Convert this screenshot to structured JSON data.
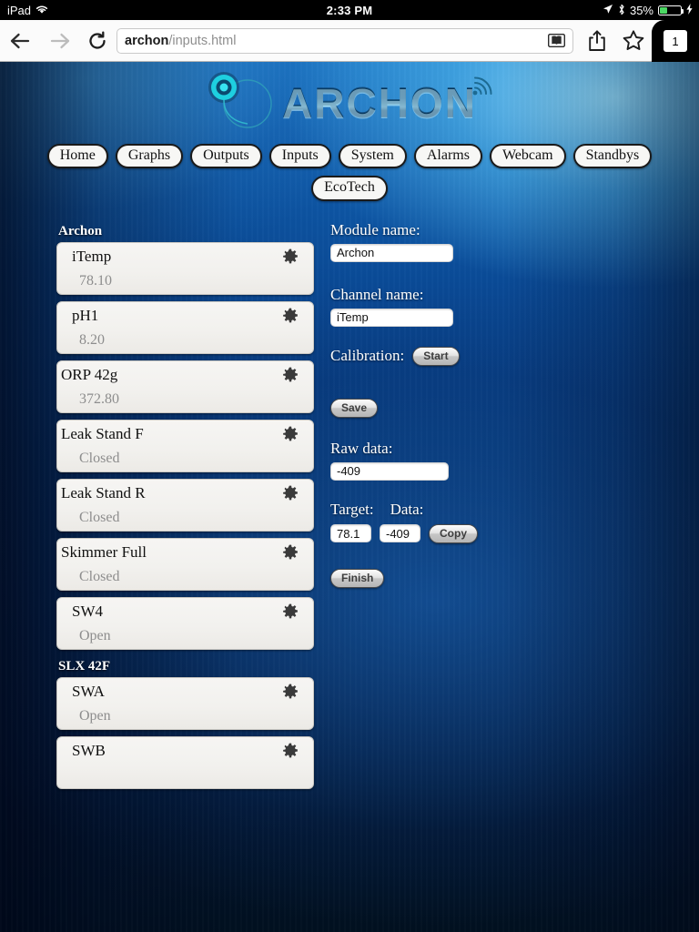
{
  "status_bar": {
    "carrier": "iPad",
    "wifi_icon": "wifi-icon",
    "time": "2:33 PM",
    "location_icon": "location-arrow-icon",
    "bluetooth_icon": "bluetooth-icon",
    "battery_percent": "35%",
    "battery_level": 35,
    "charging_icon": "lightning-bolt-icon",
    "battery_color": "#4cd964"
  },
  "browser": {
    "back_icon": "back-arrow-icon",
    "forward_icon": "forward-arrow-icon",
    "reload_icon": "reload-icon",
    "url_host": "archon",
    "url_path": "/inputs.html",
    "reader_icon": "reader-view-icon",
    "share_icon": "share-icon",
    "bookmark_icon": "star-icon",
    "tab_count": "1"
  },
  "site": {
    "logo_text": "ARCHON",
    "logo_mark_icon": "archon-swirl-icon",
    "logo_signal_icon": "signal-arcs-icon",
    "nav_row1": [
      {
        "label": "Home"
      },
      {
        "label": "Graphs"
      },
      {
        "label": "Outputs"
      },
      {
        "label": "Inputs"
      },
      {
        "label": "System"
      },
      {
        "label": "Alarms"
      },
      {
        "label": "Webcam"
      },
      {
        "label": "Standbys"
      }
    ],
    "nav_row2": [
      {
        "label": "EcoTech"
      }
    ]
  },
  "inputs_list": {
    "groups": [
      {
        "name": "Archon",
        "items": [
          {
            "title": "iTemp",
            "value": "78.10",
            "indent": true,
            "gear_icon": "gear-icon"
          },
          {
            "title": "pH1",
            "value": "8.20",
            "indent": true,
            "gear_icon": "gear-icon"
          },
          {
            "title": "ORP 42g",
            "value": "372.80",
            "indent": false,
            "gear_icon": "gear-icon"
          },
          {
            "title": "Leak Stand F",
            "value": "Closed",
            "indent": false,
            "gear_icon": "gear-icon"
          },
          {
            "title": "Leak Stand R",
            "value": "Closed",
            "indent": false,
            "gear_icon": "gear-icon"
          },
          {
            "title": "Skimmer Full",
            "value": "Closed",
            "indent": false,
            "gear_icon": "gear-icon"
          },
          {
            "title": "SW4",
            "value": "Open",
            "indent": true,
            "gear_icon": "gear-icon"
          }
        ]
      },
      {
        "name": "SLX 42F",
        "items": [
          {
            "title": "SWA",
            "value": "Open",
            "indent": true,
            "gear_icon": "gear-icon"
          },
          {
            "title": "SWB",
            "value": "",
            "indent": true,
            "gear_icon": "gear-icon"
          }
        ]
      }
    ]
  },
  "detail_panel": {
    "module_label": "Module name:",
    "module_value": "Archon",
    "channel_label": "Channel name:",
    "channel_value": "iTemp",
    "calibration_label": "Calibration:",
    "start_button": "Start",
    "save_button": "Save",
    "raw_data_label": "Raw data:",
    "raw_data_value": "-409",
    "target_label": "Target:",
    "target_value": "78.1",
    "data_label": "Data:",
    "data_value": "-409",
    "copy_button": "Copy",
    "finish_button": "Finish"
  }
}
